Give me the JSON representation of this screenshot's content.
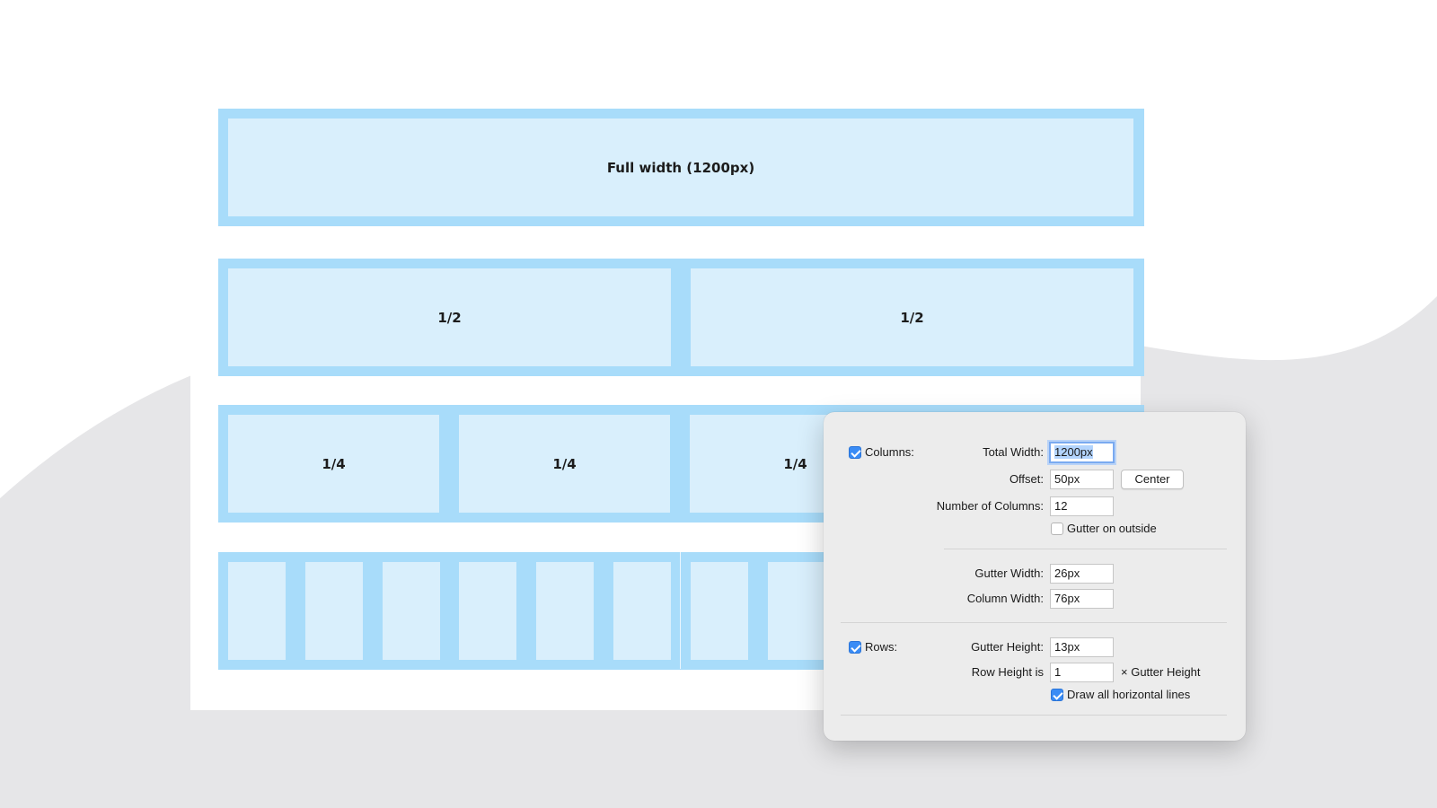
{
  "colors": {
    "row_frame": "#a8dcfa",
    "cell_fill": "#d9effc",
    "background_shape": "#e6e6e8",
    "checkbox_accent": "#3a8cf5"
  },
  "grid_preview": {
    "full_row": {
      "label": "Full width (1200px)"
    },
    "half_row": {
      "labels": [
        "1/2",
        "1/2"
      ]
    },
    "quarter_row": {
      "labels": [
        "1/4",
        "1/4",
        "1/4"
      ]
    }
  },
  "dialog": {
    "columns": {
      "checked": true,
      "checkbox_label": "Columns:",
      "total_width_label": "Total Width:",
      "total_width_value": "1200px",
      "offset_label": "Offset:",
      "offset_value": "50px",
      "center_button": "Center",
      "number_label": "Number of Columns:",
      "number_value": "12",
      "gutter_outside_checked": false,
      "gutter_outside_label": "Gutter on outside",
      "gutter_width_label": "Gutter Width:",
      "gutter_width_value": "26px",
      "column_width_label": "Column Width:",
      "column_width_value": "76px"
    },
    "rows": {
      "checked": true,
      "checkbox_label": "Rows:",
      "gutter_height_label": "Gutter Height:",
      "gutter_height_value": "13px",
      "row_height_label": "Row Height is",
      "row_height_value": "1",
      "row_height_suffix": "× Gutter Height",
      "draw_lines_checked": true,
      "draw_lines_label": "Draw all horizontal lines"
    }
  }
}
